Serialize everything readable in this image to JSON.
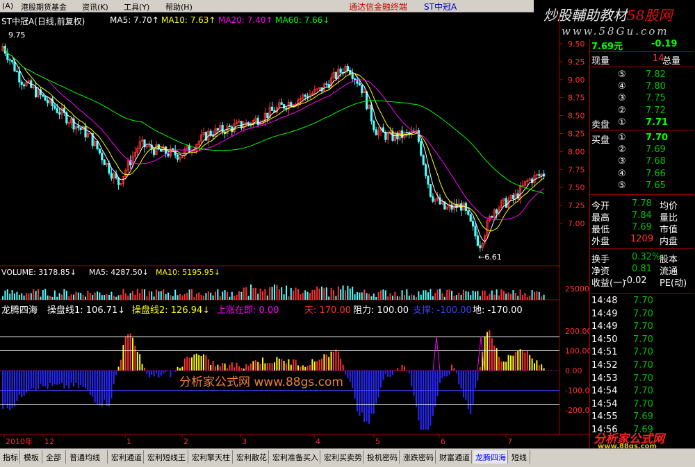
{
  "menu": {
    "item1": "(A)",
    "item2": "港股期货基金",
    "item3": "资讯(K)",
    "item4": "工具(Y)",
    "item5": "帮助(H)",
    "title": "通达信金融终端",
    "code": "ST中冠A"
  },
  "banner": {
    "line1a": "炒股輔助教材",
    "line1b": "58股网",
    "line2": "www.58Gu.com"
  },
  "price_legend": {
    "name": "ST中冠A(日线,前复权)",
    "ma5": "MA5: 7.70↑",
    "ma10": "MA10: 7.63↑",
    "ma20": "MA20: 7.40↑",
    "ma60": "MA60: 7.66↓",
    "high_mark": "9.75",
    "low_mark": "←6.61"
  },
  "volume_legend": {
    "vol": "VOLUME: 3178.85↓",
    "ma5": "MA5: 4287.50↓",
    "ma10": "MA10: 5195.95↓"
  },
  "indicator_legend": {
    "name": "龙腾四海",
    "line1": "操盘线1: 106.71↓",
    "line2": "操盘线2: 126.94↓",
    "rise": "上涨在即: 0.00",
    "tian": "天: 170.00",
    "resist": "阻力: 100.00",
    "support": "支撑: -100.00",
    "di": "地: -170.00"
  },
  "watermark": "分析家公式网 www.88gs.com",
  "price_axis": [
    "9.50",
    "9.25",
    "9.00",
    "8.75",
    "8.50",
    "8.25",
    "8.00",
    "7.75",
    "7.50",
    "7.25",
    "7.00"
  ],
  "vol_axis": "25000",
  "ind_axis": [
    "200.00",
    "100.00",
    "0.00",
    "-100.00",
    "-200.00"
  ],
  "time_axis": [
    "2010年",
    "12",
    "1",
    "2",
    "3",
    "4",
    "5",
    "6",
    "7"
  ],
  "quote": {
    "price": "7.69元",
    "change": "-0.19",
    "xianliang_label": "现量",
    "xianliang": "14",
    "zongliang_label": "总量"
  },
  "sell_label": "卖盘",
  "buy_label": "买盘",
  "sells": [
    {
      "n": "⑤",
      "p": "7.82"
    },
    {
      "n": "④",
      "p": "7.80"
    },
    {
      "n": "③",
      "p": "7.75"
    },
    {
      "n": "②",
      "p": "7.72"
    },
    {
      "n": "①",
      "p": "7.71"
    }
  ],
  "buys": [
    {
      "n": "①",
      "p": "7.70"
    },
    {
      "n": "②",
      "p": "7.69"
    },
    {
      "n": "③",
      "p": "7.68"
    },
    {
      "n": "④",
      "p": "7.66"
    },
    {
      "n": "⑤",
      "p": "7.65"
    }
  ],
  "stats": [
    {
      "a": "今开",
      "v": "7.78",
      "b": "均价"
    },
    {
      "a": "最高",
      "v": "7.84",
      "b": "量比"
    },
    {
      "a": "最低",
      "v": "7.69",
      "b": "市值"
    },
    {
      "a": "外盘",
      "v": "1209",
      "b": "内盘"
    }
  ],
  "stats2": [
    {
      "a": "换手",
      "v": "0.32%",
      "b": "股本"
    },
    {
      "a": "净资",
      "v": "0.81",
      "b": "流通"
    },
    {
      "a": "收益(一)",
      "v": "-0.02",
      "b": "PE(动)"
    }
  ],
  "ticks": [
    {
      "t": "14:48",
      "p": "7.70"
    },
    {
      "t": "14:49",
      "p": "7.70"
    },
    {
      "t": "14:49",
      "p": "7.70"
    },
    {
      "t": "14:50",
      "p": "7.70"
    },
    {
      "t": "14:51",
      "p": "7.70"
    },
    {
      "t": "14:52",
      "p": "7.70"
    },
    {
      "t": "14:53",
      "p": "7.70"
    },
    {
      "t": "14:54",
      "p": "7.70"
    },
    {
      "t": "14:54",
      "p": "7.70"
    },
    {
      "t": "14:55",
      "p": "7.69"
    },
    {
      "t": "14:56",
      "p": "7.69"
    }
  ],
  "tabs": [
    "指标",
    "模板",
    "全部",
    "普通均线",
    "宏利通道",
    "宏利短线王",
    "宏利擎天柱",
    "宏利散花",
    "宏利准备买入",
    "宏利买卖势",
    "投机密码",
    "涨跌密码",
    "财富通道",
    "龙腾四海",
    "短线"
  ],
  "active_tab": "龙腾四海",
  "logo": {
    "line1": "分析家公式网",
    "line2": "www.88gs.com"
  },
  "colors": {
    "ma5": "#ffffff",
    "ma10": "#ffff00",
    "ma20": "#ff00ff",
    "ma60": "#00ff00",
    "up": "#ff3232",
    "down": "#54fcfc"
  }
}
